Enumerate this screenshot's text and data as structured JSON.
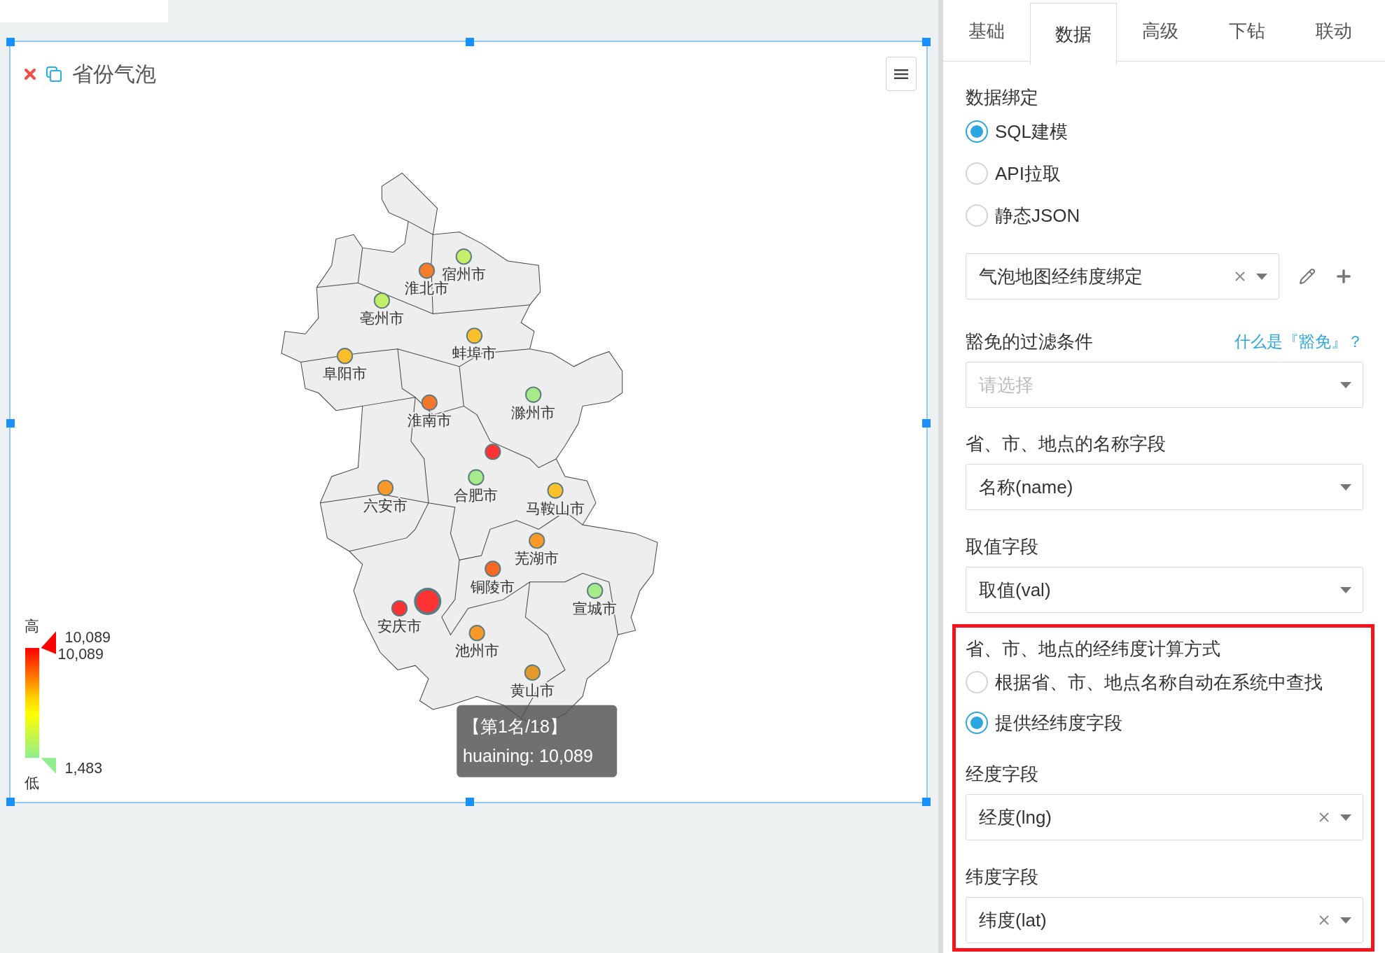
{
  "widget": {
    "title": "省份气泡",
    "selected": true
  },
  "map": {
    "cities": [
      {
        "kind": "labeled",
        "label": "宿州市",
        "color": "#c6ef6c"
      },
      {
        "kind": "labeled",
        "label": "淮北市",
        "color": "#f47c2a"
      },
      {
        "kind": "labeled",
        "label": "亳州市",
        "color": "#c3ee6a"
      },
      {
        "kind": "labeled",
        "label": "蚌埠市",
        "color": "#fbc02a"
      },
      {
        "kind": "labeled",
        "label": "阜阳市",
        "color": "#fbbd2a"
      },
      {
        "kind": "labeled",
        "label": "淮南市",
        "color": "#f5772b"
      },
      {
        "kind": "labeled",
        "label": "滁州市",
        "color": "#a6eb8a"
      },
      {
        "kind": "unlabeled",
        "color": "#ff3333"
      },
      {
        "kind": "labeled",
        "label": "合肥市",
        "color": "#a6eb8a"
      },
      {
        "kind": "labeled",
        "label": "六安市",
        "color": "#f99a28"
      },
      {
        "kind": "labeled",
        "label": "马鞍山市",
        "color": "#fcc02a"
      },
      {
        "kind": "labeled",
        "label": "芜湖市",
        "color": "#f99a28"
      },
      {
        "kind": "labeled",
        "label": "铜陵市",
        "color": "#f46a25"
      },
      {
        "kind": "labeled",
        "label": "宣城市",
        "color": "#a6eb8a"
      },
      {
        "kind": "labeled",
        "label": "安庆市",
        "color": "#ff3333"
      },
      {
        "kind": "highlighted",
        "color": "#ff3333"
      },
      {
        "kind": "labeled",
        "label": "池州市",
        "color": "#f99a28"
      },
      {
        "kind": "labeled",
        "label": "黄山市",
        "color": "#e39a2a"
      }
    ],
    "legend": {
      "high_label": "高",
      "max": "10,089",
      "handle_value": "10,089",
      "min": "1,483",
      "low_label": "低"
    },
    "tooltip": {
      "rank": "【第1名/18】",
      "text": "huaining: 10,089"
    }
  },
  "panel": {
    "tabs": [
      {
        "label": "基础",
        "selected": false
      },
      {
        "label": "数据",
        "selected": true
      },
      {
        "label": "高级",
        "selected": false
      },
      {
        "label": "下钻",
        "selected": false
      },
      {
        "label": "联动",
        "selected": false
      }
    ],
    "data_binding": {
      "label": "数据绑定",
      "options": [
        {
          "label": "SQL建模",
          "selected": true
        },
        {
          "label": "API拉取",
          "selected": false
        },
        {
          "label": "静态JSON",
          "selected": false
        }
      ]
    },
    "binding_select": {
      "value": "气泡地图经纬度绑定",
      "clearable": true
    },
    "exempt_filter": {
      "label": "豁免的过滤条件",
      "help_link": "什么是『豁免』？",
      "placeholder": "请选择"
    },
    "name_field": {
      "label": "省、市、地点的名称字段",
      "value": "名称(name)",
      "clearable": false
    },
    "value_field": {
      "label": "取值字段",
      "value": "取值(val)",
      "clearable": false
    },
    "coordinate_method": {
      "highlighted": true,
      "label": "省、市、地点的经纬度计算方式",
      "options": [
        {
          "label": "根据省、市、地点名称自动在系统中查找",
          "selected": false
        },
        {
          "label": "提供经纬度字段",
          "selected": true
        }
      ]
    },
    "lng_field": {
      "label": "经度字段",
      "value": "经度(lng)",
      "clearable": true
    },
    "lat_field": {
      "label": "纬度字段",
      "value": "纬度(lat)",
      "clearable": true
    }
  }
}
